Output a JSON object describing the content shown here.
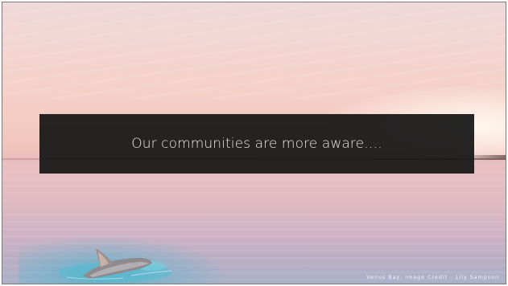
{
  "slide": {
    "headline": "Our communities are more aware….",
    "credit": "Venus Bay, Image Credit – Lily Sampson"
  },
  "background": {
    "scene": "ocean-dusk-with-dolphin",
    "colors": {
      "sky_top": "#efd8d9",
      "sky_warm": "#f4ccc2",
      "water_bottom": "#a9b1c8",
      "teal_water": "#46afc8",
      "banner": "#161616",
      "headline_text": "#e8e8e8"
    }
  }
}
